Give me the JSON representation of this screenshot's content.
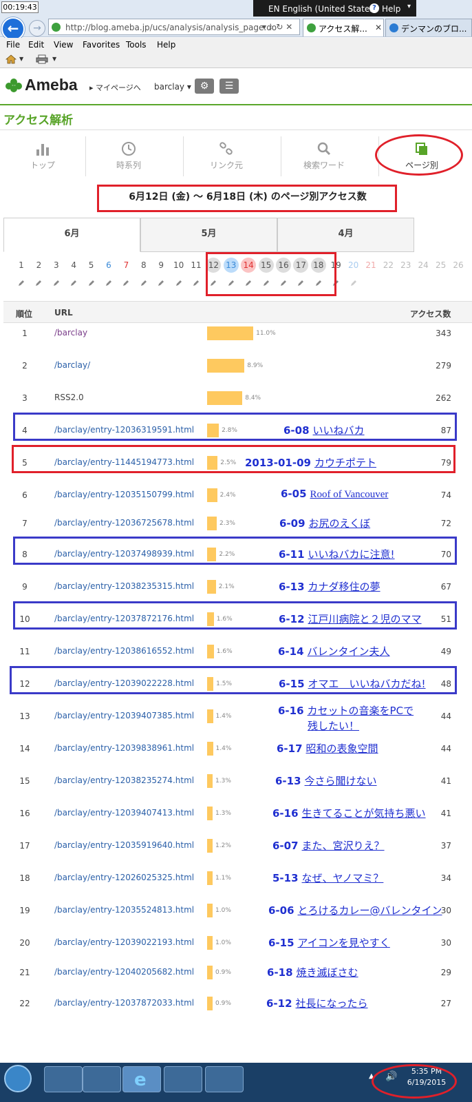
{
  "browser": {
    "clock": "00:19:43",
    "language": "EN English (United States)",
    "help": "Help",
    "address": "http://blog.ameba.jp/ucs/analysis/analysis_page.do",
    "tabs": [
      {
        "label": "アクセス解..."
      },
      {
        "label": "デンマンのブロ..."
      }
    ],
    "menu": [
      "File",
      "Edit",
      "View",
      "Favorites",
      "Tools",
      "Help"
    ]
  },
  "header": {
    "logo": "Ameba",
    "mypage": "▸ マイページへ",
    "user": "barclay ▾"
  },
  "page": {
    "heading": "アクセス解析",
    "nav": [
      {
        "label": "トップ"
      },
      {
        "label": "時系列"
      },
      {
        "label": "リンク元"
      },
      {
        "label": "検索ワード"
      },
      {
        "label": "ページ別"
      }
    ],
    "range_title": "6月12日 (金) ～ 6月18日 (木) のページ別アクセス数",
    "month_tabs": [
      "6月",
      "5月",
      "4月"
    ],
    "days": [
      "1",
      "2",
      "3",
      "4",
      "5",
      "6",
      "7",
      "8",
      "9",
      "10",
      "11",
      "12",
      "13",
      "14",
      "15",
      "16",
      "17",
      "18",
      "19",
      "20",
      "21",
      "22",
      "23",
      "24",
      "25",
      "26"
    ]
  },
  "table": {
    "headers": {
      "rank": "順位",
      "url": "URL",
      "count": "アクセス数"
    },
    "rows": [
      {
        "rank": "1",
        "url": "/barclay",
        "pct": "11.0%",
        "pct_value": 11.0,
        "count": "343",
        "annot_date": "",
        "annot_title": ""
      },
      {
        "rank": "2",
        "url": "/barclay/",
        "pct": "8.9%",
        "pct_value": 8.9,
        "count": "279",
        "annot_date": "",
        "annot_title": ""
      },
      {
        "rank": "3",
        "url": "RSS2.0",
        "pct": "8.4%",
        "pct_value": 8.4,
        "count": "262",
        "annot_date": "",
        "annot_title": ""
      },
      {
        "rank": "4",
        "url": "/barclay/entry-12036319591.html",
        "pct": "2.8%",
        "pct_value": 2.8,
        "count": "87",
        "annot_date": "6-08",
        "annot_title": "いいねバカ"
      },
      {
        "rank": "5",
        "url": "/barclay/entry-11445194773.html",
        "pct": "2.5%",
        "pct_value": 2.5,
        "count": "79",
        "annot_date": "2013-01-09",
        "annot_title": "カウチポテト"
      },
      {
        "rank": "6",
        "url": "/barclay/entry-12035150799.html",
        "pct": "2.4%",
        "pct_value": 2.4,
        "count": "74",
        "annot_date": "6-05",
        "annot_title": "Roof of Vancouver"
      },
      {
        "rank": "7",
        "url": "/barclay/entry-12036725678.html",
        "pct": "2.3%",
        "pct_value": 2.3,
        "count": "72",
        "annot_date": "6-09",
        "annot_title": "お尻のえくぼ"
      },
      {
        "rank": "8",
        "url": "/barclay/entry-12037498939.html",
        "pct": "2.2%",
        "pct_value": 2.2,
        "count": "70",
        "annot_date": "6-11",
        "annot_title": "いいねバカに注意!"
      },
      {
        "rank": "9",
        "url": "/barclay/entry-12038235315.html",
        "pct": "2.1%",
        "pct_value": 2.1,
        "count": "67",
        "annot_date": "6-13",
        "annot_title": "カナダ移住の夢"
      },
      {
        "rank": "10",
        "url": "/barclay/entry-12037872176.html",
        "pct": "1.6%",
        "pct_value": 1.6,
        "count": "51",
        "annot_date": "6-12",
        "annot_title": "江戸川病院と２児のママ"
      },
      {
        "rank": "11",
        "url": "/barclay/entry-12038616552.html",
        "pct": "1.6%",
        "pct_value": 1.6,
        "count": "49",
        "annot_date": "6-14",
        "annot_title": "バレンタイン夫人"
      },
      {
        "rank": "12",
        "url": "/barclay/entry-12039022228.html",
        "pct": "1.5%",
        "pct_value": 1.5,
        "count": "48",
        "annot_date": "6-15",
        "annot_title": "オマエ　いいねバカだね!"
      },
      {
        "rank": "13",
        "url": "/barclay/entry-12039407385.html",
        "pct": "1.4%",
        "pct_value": 1.4,
        "count": "44",
        "annot_date": "6-16",
        "annot_title": "カセットの音楽をPCで",
        "annot_title2": "残したい！"
      },
      {
        "rank": "14",
        "url": "/barclay/entry-12039838961.html",
        "pct": "1.4%",
        "pct_value": 1.4,
        "count": "44",
        "annot_date": "6-17",
        "annot_title": "昭和の表象空間"
      },
      {
        "rank": "15",
        "url": "/barclay/entry-12038235274.html",
        "pct": "1.3%",
        "pct_value": 1.3,
        "count": "41",
        "annot_date": "6-13",
        "annot_title": "今さら聞けない"
      },
      {
        "rank": "16",
        "url": "/barclay/entry-12039407413.html",
        "pct": "1.3%",
        "pct_value": 1.3,
        "count": "41",
        "annot_date": "6-16",
        "annot_title": "生きてることが気持ち悪い"
      },
      {
        "rank": "17",
        "url": "/barclay/entry-12035919640.html",
        "pct": "1.2%",
        "pct_value": 1.2,
        "count": "37",
        "annot_date": "6-07",
        "annot_title": "また、宮沢りえ？"
      },
      {
        "rank": "18",
        "url": "/barclay/entry-12026025325.html",
        "pct": "1.1%",
        "pct_value": 1.1,
        "count": "34",
        "annot_date": "5-13",
        "annot_title": "なぜ、ヤノマミ？"
      },
      {
        "rank": "19",
        "url": "/barclay/entry-12035524813.html",
        "pct": "1.0%",
        "pct_value": 1.0,
        "count": "30",
        "annot_date": "6-06",
        "annot_title": "とろけるカレー@バレンタイン"
      },
      {
        "rank": "20",
        "url": "/barclay/entry-12039022193.html",
        "pct": "1.0%",
        "pct_value": 1.0,
        "count": "30",
        "annot_date": "6-15",
        "annot_title": "アイコンを見やすく"
      },
      {
        "rank": "21",
        "url": "/barclay/entry-12040205682.html",
        "pct": "0.9%",
        "pct_value": 0.9,
        "count": "29",
        "annot_date": "6-18",
        "annot_title": "焼き滅ぼさむ"
      },
      {
        "rank": "22",
        "url": "/barclay/entry-12037872033.html",
        "pct": "0.9%",
        "pct_value": 0.9,
        "count": "27",
        "annot_date": "6-12",
        "annot_title": "社長になったら"
      }
    ]
  },
  "taskbar": {
    "time": "5:35 PM",
    "date": "6/19/2015"
  }
}
